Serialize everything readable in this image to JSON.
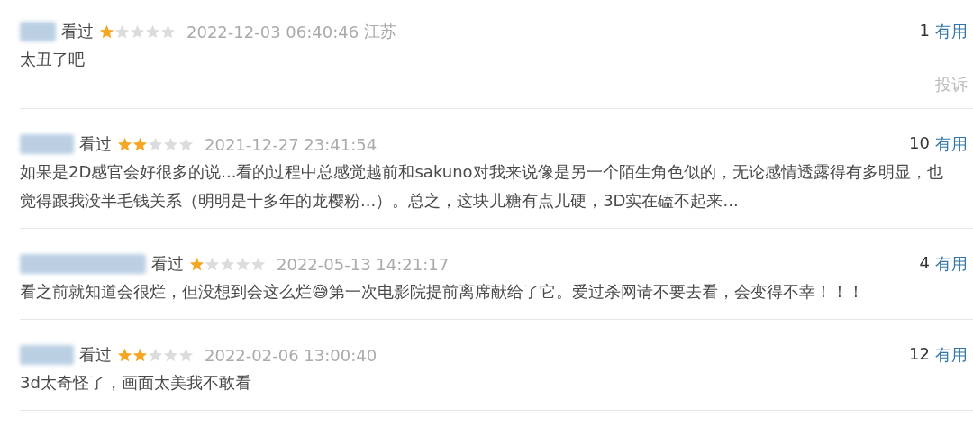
{
  "reviews": [
    {
      "status": "看过",
      "stars": 1,
      "time": "2022-12-03 06:40:46",
      "location": "江苏",
      "votes": "1",
      "vote_label": "有用",
      "content": "太丑了吧",
      "report": "投诉"
    },
    {
      "status": "看过",
      "stars": 2,
      "time": "2021-12-27 23:41:54",
      "votes": "10",
      "vote_label": "有用",
      "content": "如果是2D感官会好很多的说...看的过程中总感觉越前和sakuno对我来说像是另一个陌生角色似的，无论感情透露得有多明显，也觉得跟我没半毛钱关系（明明是十多年的龙樱粉...）。总之，这块儿糖有点儿硬，3D实在磕不起来..."
    },
    {
      "status": "看过",
      "stars": 1,
      "time": "2022-05-13 14:21:17",
      "votes": "4",
      "vote_label": "有用",
      "content": "看之前就知道会很烂，但没想到会这么烂😅第一次电影院提前离席献给了它。爱过杀网请不要去看，会变得不幸！！！"
    },
    {
      "status": "看过",
      "stars": 2,
      "time": "2022-02-06 13:00:40",
      "votes": "12",
      "vote_label": "有用",
      "content": "3d太奇怪了，画面太美我不敢看"
    }
  ]
}
